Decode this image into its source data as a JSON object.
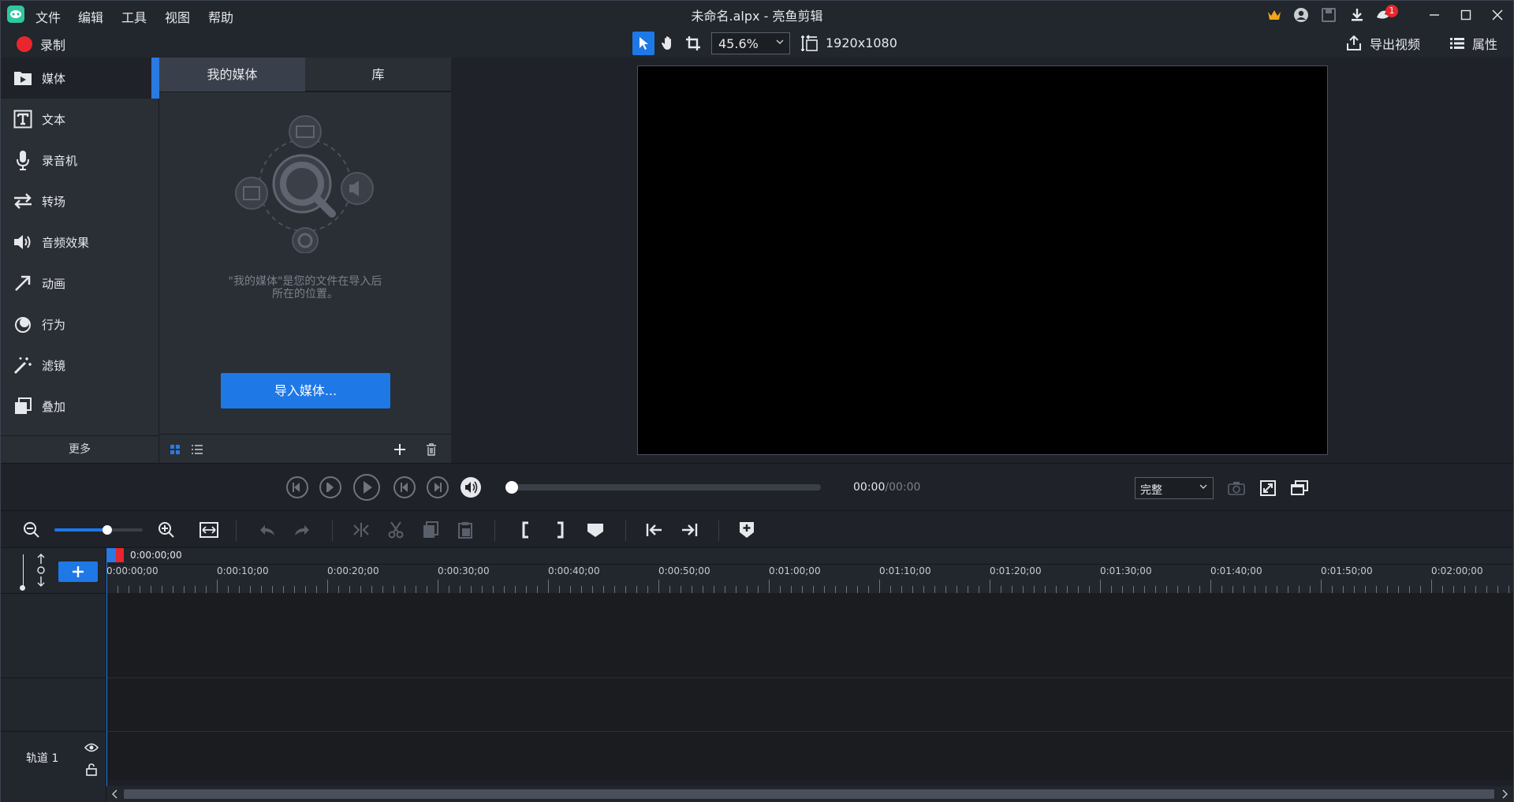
{
  "window": {
    "title": "未命名.alpx - 亮鱼剪辑"
  },
  "menu": {
    "file": "文件",
    "edit": "编辑",
    "tools": "工具",
    "view": "视图",
    "help": "帮助"
  },
  "notification_count": "1",
  "toolbar": {
    "record_label": "录制",
    "zoom_value": "45.6%",
    "resolution": "1920x1080",
    "export_label": "导出视频",
    "properties_label": "属性"
  },
  "nav": {
    "items": [
      {
        "label": "媒体",
        "icon": "media-icon"
      },
      {
        "label": "文本",
        "icon": "text-icon"
      },
      {
        "label": "录音机",
        "icon": "microphone-icon"
      },
      {
        "label": "转场",
        "icon": "transition-icon"
      },
      {
        "label": "音频效果",
        "icon": "speaker-icon"
      },
      {
        "label": "动画",
        "icon": "arrow-icon"
      },
      {
        "label": "行为",
        "icon": "behavior-icon"
      },
      {
        "label": "滤镜",
        "icon": "magic-wand-icon"
      },
      {
        "label": "叠加",
        "icon": "overlay-icon"
      }
    ],
    "more_label": "更多"
  },
  "media_panel": {
    "tabs": [
      "我的媒体",
      "库"
    ],
    "hint_line1": "\"我的媒体\"是您的文件在导入后",
    "hint_line2": "所在的位置。",
    "import_label": "导入媒体..."
  },
  "playback": {
    "time_current": "00:00",
    "time_total": "/00:00",
    "quality": "完整"
  },
  "timeline": {
    "playhead_time": "0:00:00;00",
    "ticks": [
      "0:00:00;00",
      "0:00:10;00",
      "0:00:20;00",
      "0:00:30;00",
      "0:00:40;00",
      "0:00:50;00",
      "0:01:00;00",
      "0:01:10;00",
      "0:01:20;00",
      "0:01:30;00",
      "0:01:40;00",
      "0:01:50;00",
      "0:02:00;00"
    ],
    "track_label": "轨道 1",
    "zoom_level": 0.6
  },
  "colors": {
    "accent": "#1e78e6",
    "record": "#e8262d",
    "background": "#1d2026"
  }
}
